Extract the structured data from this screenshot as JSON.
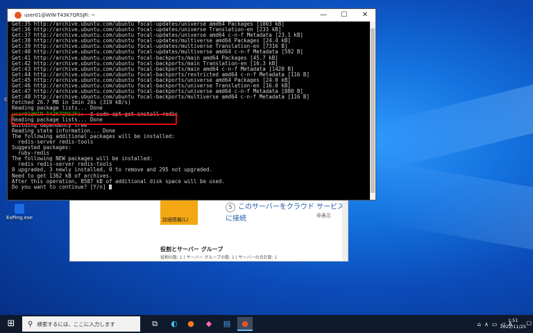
{
  "terminal": {
    "title": "user01@WIN-T43K7QRSJFi: ~",
    "min": "—",
    "max": "☐",
    "close": "✕",
    "lines_before": [
      "Get:35 http://archive.ubuntu.com/ubuntu focal-updates/universe amd64 Packages [1003 kB]",
      "Get:36 http://archive.ubuntu.com/ubuntu focal-updates/universe Translation-en [233 kB]",
      "Get:37 http://archive.ubuntu.com/ubuntu focal-updates/universe amd64 c-n-f Metadata [23.1 kB]",
      "Get:38 http://archive.ubuntu.com/ubuntu focal-updates/multiverse amd64 Packages [24.4 kB]",
      "Get:39 http://archive.ubuntu.com/ubuntu focal-updates/multiverse Translation-en [7316 B]",
      "Get:40 http://archive.ubuntu.com/ubuntu focal-updates/multiverse amd64 c-n-f Metadata [592 B]",
      "Get:41 http://archive.ubuntu.com/ubuntu focal-backports/main amd64 Packages [45.7 kB]",
      "Get:42 http://archive.ubuntu.com/ubuntu focal-backports/main Translation-en [16.3 kB]",
      "Get:43 http://archive.ubuntu.com/ubuntu focal-backports/main amd64 c-n-f Metadata [1420 B]",
      "Get:44 http://archive.ubuntu.com/ubuntu focal-backports/restricted amd64 c-n-f Metadata [116 B]",
      "Get:45 http://archive.ubuntu.com/ubuntu focal-backports/universe amd64 Packages [24.0 kB]",
      "Get:46 http://archive.ubuntu.com/ubuntu focal-backports/universe Translation-en [16.0 kB]",
      "Get:47 http://archive.ubuntu.com/ubuntu focal-backports/universe amd64 c-n-f Metadata [880 B]",
      "Get:48 http://archive.ubuntu.com/ubuntu focal-backports/multiverse amd64 c-n-f Metadata [116 B]",
      "Fetched 26.7 MB in 1min 24s (319 kB/s)",
      "Reading package lists... Done"
    ],
    "prompt_user": "user01@WIN-T43K7QRSJFi",
    "prompt_path": ":~",
    "command": "$ sudo apt-get install redis",
    "lines_after": [
      "Reading package lists... Done",
      "Building dependency tree",
      "Reading state information... Done",
      "The following additional packages will be installed:",
      "  redis-server redis-tools",
      "Suggested packages:",
      "  ruby-redis",
      "The following NEW packages will be installed:",
      "  redis redis-server redis-tools",
      "0 upgraded, 3 newly installed, 0 to remove and 295 not upgraded.",
      "Need to get 1362 kB of archives.",
      "After this operation, 8587 kB of additional disk space will be used.",
      "Do you want to continue? [Y/n] "
    ]
  },
  "server_manager": {
    "step_num": "5",
    "step_text": "このサーバーをクラウド サービスに接続",
    "hide_text": "非表示",
    "detail_text": "詳細情報(L)",
    "group_title": "役割とサーバー グループ",
    "group_sub": "役割の数: 1 | サーバー グループの数: 1 | サーバーの合計数: 1"
  },
  "desktop": {
    "icon_label": "ExPing.exe",
    "side_label": "Goo"
  },
  "taskbar": {
    "search_placeholder": "検索するには、ここに入力します",
    "time": "1:51",
    "date": "2022/11/25",
    "ime": "A"
  }
}
